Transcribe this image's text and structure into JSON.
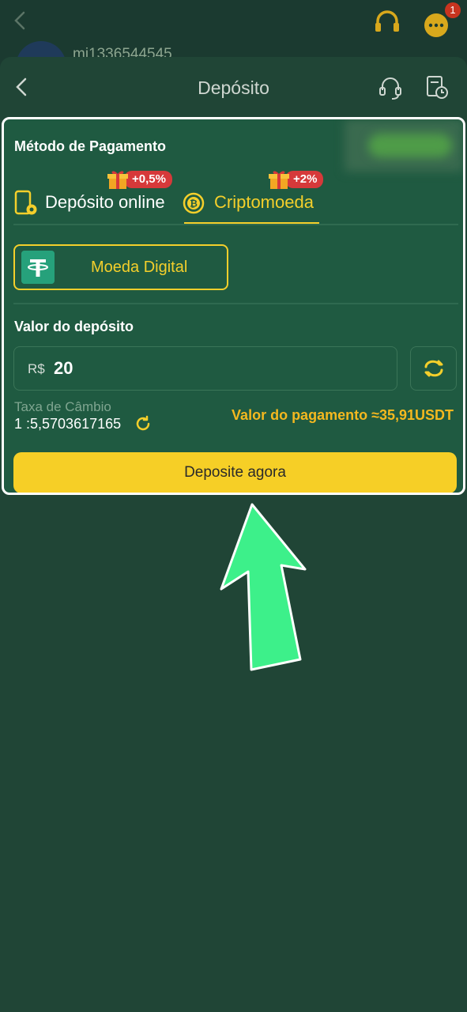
{
  "background": {
    "username": "mi1336544545",
    "notification_count": "1"
  },
  "sheet": {
    "title": "Depósito"
  },
  "payment": {
    "section_title": "Método de Pagamento",
    "tabs": [
      {
        "label": "Depósito online",
        "promo": "+0,5%",
        "active": false
      },
      {
        "label": "Criptomoeda",
        "promo": "+2%",
        "active": true
      }
    ],
    "coin_option": "Moeda Digital"
  },
  "amount": {
    "title": "Valor do depósito",
    "currency": "R$",
    "value": "20"
  },
  "exchange": {
    "label": "Taxa de Câmbio",
    "rate": "1 :5,5703617165",
    "payment_value": "Valor do pagamento ≈35,91USDT"
  },
  "deposit_button": "Deposite agora",
  "colors": {
    "accent": "#f4cf2b",
    "card": "#1f5a41",
    "background": "#1d3e33",
    "promo": "#d6393a",
    "arrow": "#3df08a"
  }
}
